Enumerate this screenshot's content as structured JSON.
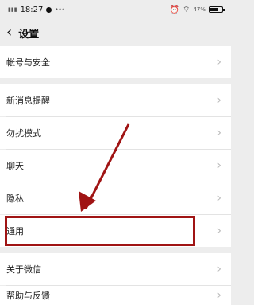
{
  "statusbar": {
    "time": "18:27",
    "battery": "47%"
  },
  "header": {
    "back_icon": "‹",
    "title": "设置"
  },
  "settings_items": [
    {
      "label": "帐号与安全"
    },
    {
      "label": "新消息提醒"
    },
    {
      "label": "勿扰模式"
    },
    {
      "label": "聊天"
    },
    {
      "label": "隐私"
    },
    {
      "label": "通用"
    },
    {
      "label": "关于微信"
    },
    {
      "label": "帮助与反馈"
    }
  ],
  "chevron": "›",
  "annotation_color": "#a01414"
}
